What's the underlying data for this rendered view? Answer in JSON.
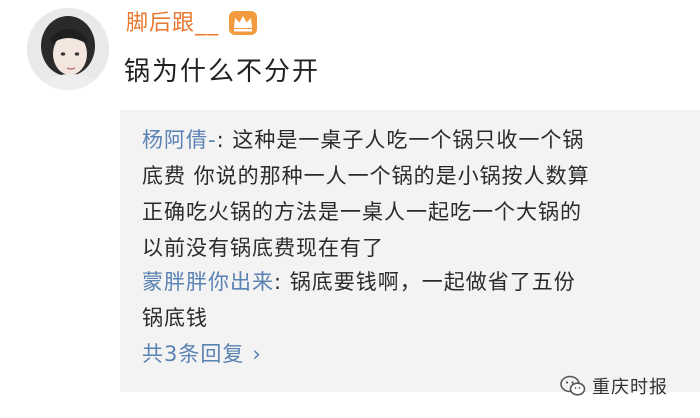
{
  "post": {
    "username": "脚后跟__",
    "text": "锅为什么不分开"
  },
  "replies": [
    {
      "author": "杨阿倩-",
      "separator": ":",
      "text": " 这种是一桌子人吃一个锅只收一个锅\n底费 你说的那种一人一个锅的是小锅按人数算\n正确吃火锅的方法是一桌人一起吃一个大锅的\n以前没有锅底费现在有了"
    },
    {
      "author": "蒙胖胖你出来",
      "separator": ":",
      "text": " 锅底要钱啊，一起做省了五份\n锅底钱"
    }
  ],
  "more_replies": {
    "label": "共3条回复",
    "chevron": "›"
  },
  "watermark": {
    "label": "重庆时报",
    "icon": "wechat-icon"
  },
  "colors": {
    "username": "#e8792e",
    "link": "#5a82b3",
    "reply_bg": "#f3f3f3"
  }
}
